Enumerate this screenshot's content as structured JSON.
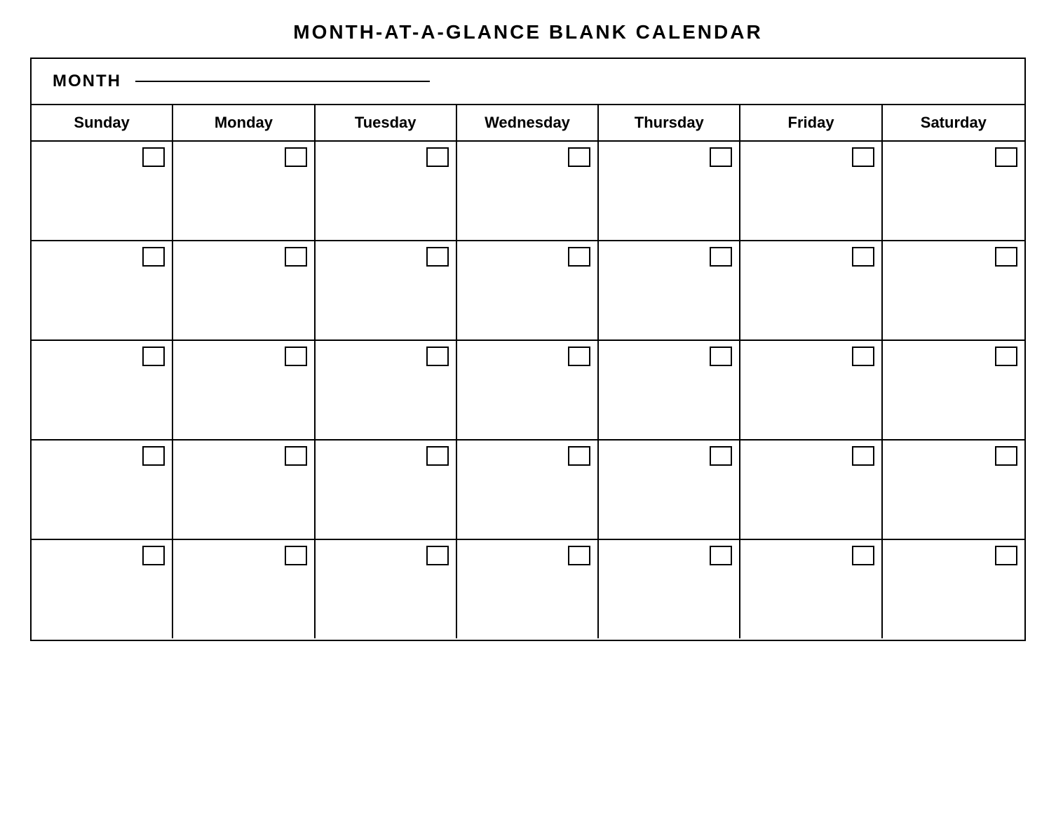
{
  "title": "MONTH-AT-A-GLANCE  BLANK  CALENDAR",
  "month_label": "MONTH",
  "days": [
    {
      "label": "Sunday"
    },
    {
      "label": "Monday"
    },
    {
      "label": "Tuesday"
    },
    {
      "label": "Wednesday"
    },
    {
      "label": "Thursday"
    },
    {
      "label": "Friday"
    },
    {
      "label": "Saturday"
    }
  ],
  "rows": 5,
  "cols": 7
}
